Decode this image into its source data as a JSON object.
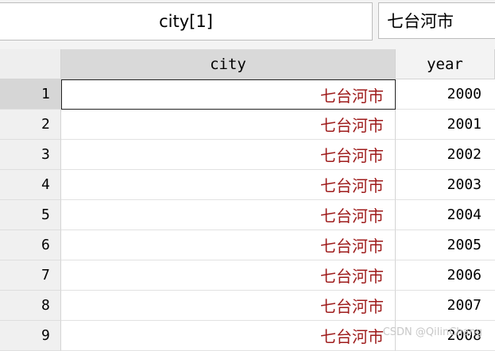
{
  "name_box": "city[1]",
  "value_box": "七台河市",
  "columns": [
    "city",
    "year"
  ],
  "rows": [
    {
      "num": "1",
      "city": "七台河市",
      "year": "2000"
    },
    {
      "num": "2",
      "city": "七台河市",
      "year": "2001"
    },
    {
      "num": "3",
      "city": "七台河市",
      "year": "2002"
    },
    {
      "num": "4",
      "city": "七台河市",
      "year": "2003"
    },
    {
      "num": "5",
      "city": "七台河市",
      "year": "2004"
    },
    {
      "num": "6",
      "city": "七台河市",
      "year": "2005"
    },
    {
      "num": "7",
      "city": "七台河市",
      "year": "2006"
    },
    {
      "num": "8",
      "city": "七台河市",
      "year": "2007"
    },
    {
      "num": "9",
      "city": "七台河市",
      "year": "2008"
    }
  ],
  "watermark": "CSDN @QilinChang",
  "colors": {
    "string_text": "#9e1b1b",
    "selected_header": "#d9d9d9"
  }
}
